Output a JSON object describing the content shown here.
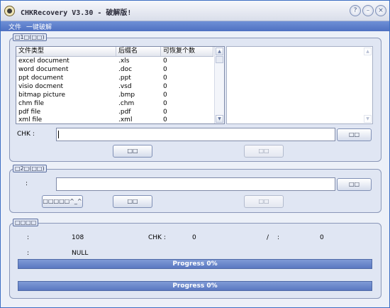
{
  "window": {
    "title": "CHKRecovery V3.30 - 破解版!",
    "buttons": {
      "help": "?",
      "minimize": "–",
      "close": "×"
    }
  },
  "menu": {
    "items": [
      "文件",
      "一键破解"
    ]
  },
  "group1": {
    "label": "□1□(□□)",
    "columns": [
      "文件类型",
      "后缀名",
      "可恢复个数"
    ],
    "rows": [
      [
        "excel document",
        ".xls",
        "0"
      ],
      [
        "word document",
        ".doc",
        "0"
      ],
      [
        "ppt document",
        ".ppt",
        "0"
      ],
      [
        "visio docment",
        ".vsd",
        "0"
      ],
      [
        "bitmap picture",
        ".bmp",
        "0"
      ],
      [
        "chm file",
        ".chm",
        "0"
      ],
      [
        "pdf file",
        ".pdf",
        "0"
      ],
      [
        "xml file",
        ".xml",
        "0"
      ]
    ],
    "chk_label": "CHK :",
    "chk_value": "",
    "browse_button": "□□",
    "button_a": "□□",
    "button_b": "□□"
  },
  "group2": {
    "label": "□2□(□□)",
    "field_label": ":",
    "field_value": "",
    "browse_button": "□□",
    "button_open": "□□□□□^_^",
    "button_a": "□□",
    "button_b": "□□"
  },
  "group3": {
    "label": "□□□□",
    "row1": {
      "label_a": ":",
      "value_a": "108",
      "chk_label": "CHK :",
      "chk_value": "0",
      "slash": "/",
      "colon": ":",
      "value_c": "0"
    },
    "row2": {
      "label": ":",
      "value": "NULL"
    },
    "progress1": {
      "text": "Progress 0%",
      "percent": 0
    },
    "progress2": {
      "text": "Progress 0%",
      "percent": 0
    }
  }
}
